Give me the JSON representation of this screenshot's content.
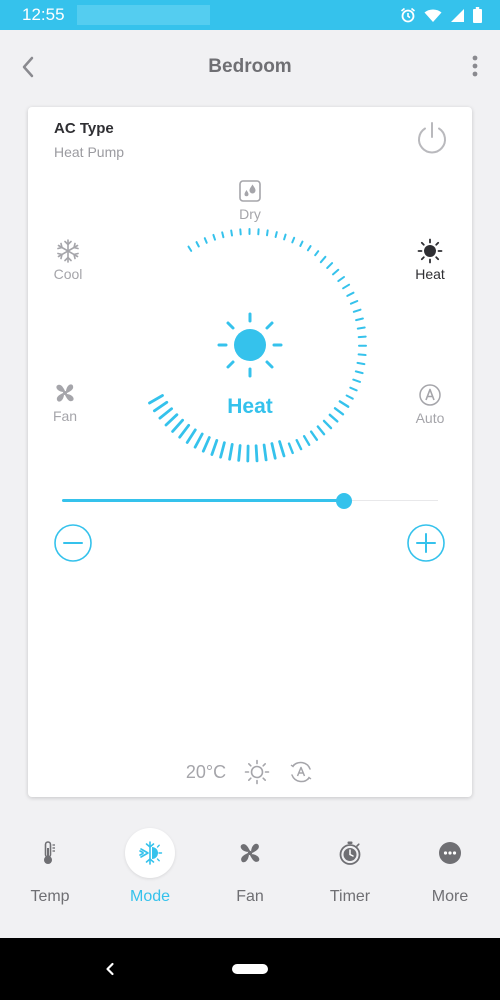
{
  "status_bar": {
    "time": "12:55",
    "icons": [
      "alarm-icon",
      "wifi-icon",
      "signal-icon",
      "battery-icon"
    ]
  },
  "header": {
    "title": "Bedroom"
  },
  "ac": {
    "type_label": "AC Type",
    "type_value": "Heat Pump"
  },
  "modes": {
    "dry": "Dry",
    "cool": "Cool",
    "heat": "Heat",
    "fan": "Fan",
    "auto": "Auto",
    "selected": "Heat"
  },
  "dial": {
    "label": "Heat"
  },
  "slider": {
    "fraction": 0.75
  },
  "summary": {
    "temperature": "20°C",
    "mode_icon": "sun-icon",
    "fan_icon": "auto-fan-icon"
  },
  "tabs": [
    {
      "label": "Temp",
      "icon": "thermometer-icon"
    },
    {
      "label": "Mode",
      "icon": "mode-icon",
      "active": true
    },
    {
      "label": "Fan",
      "icon": "fan-icon"
    },
    {
      "label": "Timer",
      "icon": "timer-icon"
    },
    {
      "label": "More",
      "icon": "more-icon"
    }
  ],
  "colors": {
    "accent": "#35c2ec",
    "text_dark": "#2f2f33",
    "text_muted": "#a5a5aa",
    "background": "#f1f1f3"
  }
}
